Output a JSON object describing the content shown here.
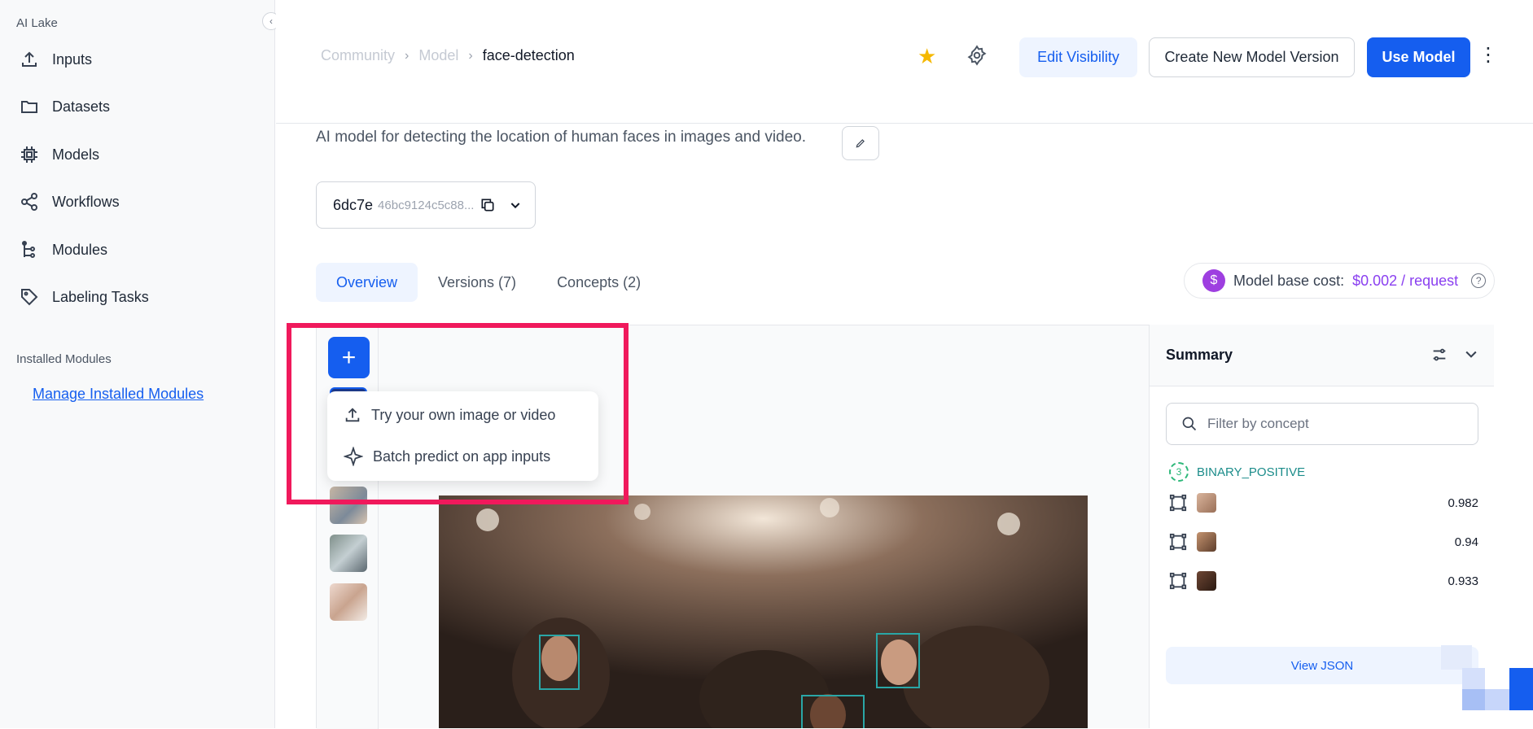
{
  "sidebar": {
    "section_title": "AI Lake",
    "items": [
      {
        "label": "Inputs",
        "icon": "upload-icon"
      },
      {
        "label": "Datasets",
        "icon": "folder-icon"
      },
      {
        "label": "Models",
        "icon": "chip-icon"
      },
      {
        "label": "Workflows",
        "icon": "share-nodes-icon"
      },
      {
        "label": "Modules",
        "icon": "tree-icon"
      },
      {
        "label": "Labeling Tasks",
        "icon": "tag-icon"
      }
    ],
    "installed_title": "Installed Modules",
    "manage_link": "Manage Installed Modules"
  },
  "header": {
    "breadcrumb": [
      "Community",
      "Model",
      "face-detection"
    ],
    "edit_visibility": "Edit Visibility",
    "create_version": "Create New Model Version",
    "use_model": "Use Model"
  },
  "model": {
    "description": "AI model for detecting the location of human faces in images and video.",
    "version_id": "6dc7e",
    "version_hash": "46bc9124c5c88..."
  },
  "tabs": [
    "Overview",
    "Versions (7)",
    "Concepts (2)"
  ],
  "active_tab": "Overview",
  "cost": {
    "label": "Model base cost:",
    "value": "$0.002 / request"
  },
  "menu": {
    "try_own": "Try your own image or video",
    "batch_predict": "Batch predict on app inputs"
  },
  "summary": {
    "title": "Summary",
    "filter_placeholder": "Filter by concept",
    "concept_count": "3",
    "concept_name": "BINARY_POSITIVE",
    "predictions": [
      {
        "score": "0.982"
      },
      {
        "score": "0.94"
      },
      {
        "score": "0.933"
      }
    ],
    "view_json": "View JSON"
  },
  "colors": {
    "accent": "#155eef",
    "highlight": "#f0195c",
    "star": "#f5b800",
    "cost": "#8a3ff0"
  }
}
